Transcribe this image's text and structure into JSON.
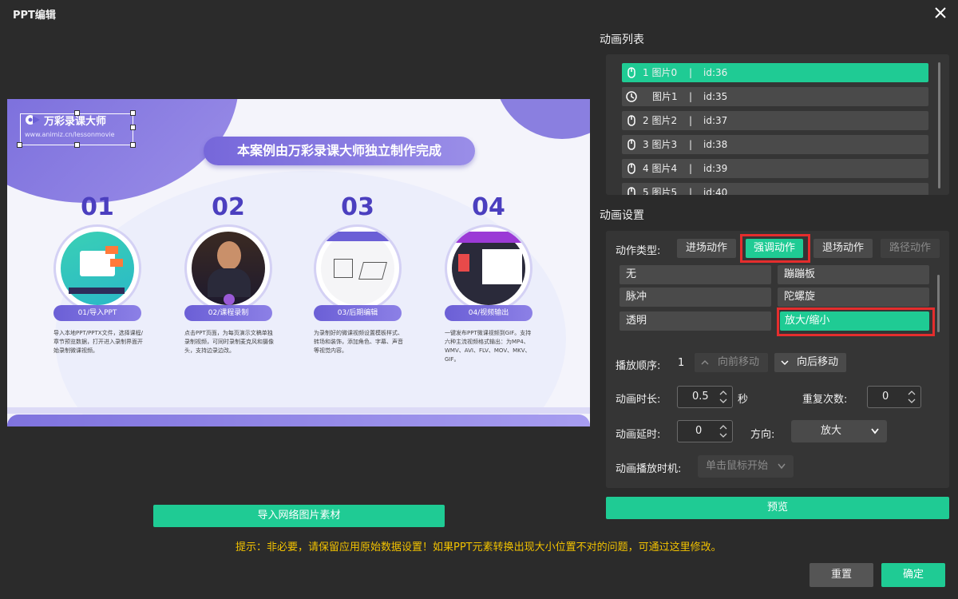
{
  "window": {
    "title": "PPT编辑"
  },
  "slide": {
    "logo_text": "万彩录课大师",
    "logo_url": "www.animiz.cn/lessonmovie",
    "banner": "本案例由万彩录课大师独立制作完成",
    "steps": [
      {
        "num": "01",
        "label": "01/导入PPT",
        "desc": "导入本地PPT/PPTX文件，选择课程/章节预览数据，打开进入录制界面开始录制微课视频。"
      },
      {
        "num": "02",
        "label": "02/课程录制",
        "desc": "点击PPT页面，为每页演示文稿单独录制视频，可同时录制麦克风和摄像头，支持边录边改。"
      },
      {
        "num": "03",
        "label": "03/后期编辑",
        "desc": "为录制好的微课视频设置模板样式、转场和装饰，添加角色、字幕、声音等视觉内容。"
      },
      {
        "num": "04",
        "label": "04/视频输出",
        "desc": "一键发布PPT微课视频到GIF。支持六种主流视频格式输出：为MP4、WMV、AVI、FLV、MOV、MKV、GIF。"
      }
    ]
  },
  "buttons": {
    "import_web": "导入网络图片素材",
    "preview": "预览",
    "reset": "重置",
    "confirm": "确定"
  },
  "tip": "提示：非必要，请保留应用原始数据设置！如果PPT元素转换出现大小位置不对的问题，可通过这里修改。",
  "animation_list": {
    "title": "动画列表",
    "items": [
      {
        "label": "1 图片0",
        "sep": "|",
        "id": "id:36",
        "icon": "mouse-icon",
        "active": true
      },
      {
        "label": "图片1",
        "sep": "|",
        "id": "id:35",
        "icon": "clock-icon",
        "active": false
      },
      {
        "label": "2 图片2",
        "sep": "|",
        "id": "id:37",
        "icon": "mouse-icon",
        "active": false
      },
      {
        "label": "3 图片3",
        "sep": "|",
        "id": "id:38",
        "icon": "mouse-icon",
        "active": false
      },
      {
        "label": "4 图片4",
        "sep": "|",
        "id": "id:39",
        "icon": "mouse-icon",
        "active": false
      },
      {
        "label": "5 图片5",
        "sep": "|",
        "id": "id:40",
        "icon": "mouse-icon",
        "active": false
      }
    ]
  },
  "animation_settings": {
    "title": "动画设置",
    "action_type_label": "动作类型:",
    "tabs": [
      "进场动作",
      "强调动作",
      "退场动作",
      "路径动作"
    ],
    "effects": [
      "无",
      "蹦蹦板",
      "脉冲",
      "陀螺旋",
      "透明",
      "放大/缩小"
    ],
    "order_label": "播放顺序:",
    "order_value": "1",
    "move_up": "向前移动",
    "move_down": "向后移动",
    "duration_label": "动画时长:",
    "duration_value": "0.5",
    "duration_unit": "秒",
    "repeat_label": "重复次数:",
    "repeat_value": "0",
    "delay_label": "动画延时:",
    "delay_value": "0",
    "direction_label": "方向:",
    "direction_value": "放大",
    "trigger_label": "动画播放时机:",
    "trigger_value": "单击鼠标开始"
  },
  "colors": {
    "accent": "#1fcb94",
    "highlight": "#e52d2d",
    "tip": "#f2c200",
    "bg": "#2b2b2b"
  }
}
